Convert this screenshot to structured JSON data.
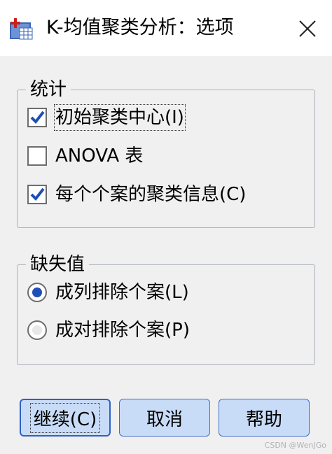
{
  "window": {
    "title": "K-均值聚类分析：选项",
    "app_icon": "spss-dialog-icon",
    "close_icon": "close-icon"
  },
  "statistics": {
    "legend": "统计",
    "options": [
      {
        "label": "初始聚类中心(I)",
        "checked": true,
        "focused": true
      },
      {
        "label": "ANOVA 表",
        "checked": false,
        "focused": false
      },
      {
        "label": "每个个案的聚类信息(C)",
        "checked": true,
        "focused": false
      }
    ]
  },
  "missing": {
    "legend": "缺失值",
    "options": [
      {
        "label": "成列排除个案(L)",
        "selected": true
      },
      {
        "label": "成对排除个案(P)",
        "selected": false
      }
    ]
  },
  "buttons": {
    "continue": "继续(C)",
    "cancel": "取消",
    "help": "帮助"
  },
  "watermark": "CSDN @WenJGo",
  "colors": {
    "button_fill": "#c9dcf7",
    "button_border": "#3d6fc9",
    "check": "#1f4fb5",
    "dialog_bg": "#f0f0f0"
  }
}
